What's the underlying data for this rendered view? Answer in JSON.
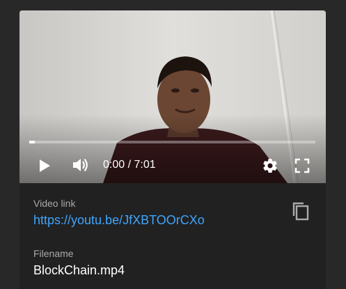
{
  "player": {
    "time_display": "0:00 / 7:01",
    "progress_fraction": 0.02
  },
  "details": {
    "video_link_label": "Video link",
    "video_link_url": "https://youtu.be/JfXBTOOrCXo",
    "filename_label": "Filename",
    "filename_value": "BlockChain.mp4"
  },
  "icons": {
    "play": "play-icon",
    "volume": "volume-icon",
    "settings": "gear-icon",
    "fullscreen": "fullscreen-icon",
    "copy": "copy-icon"
  },
  "colors": {
    "background": "#282828",
    "card": "#212121",
    "link": "#3ea6ff",
    "label": "#aaaaaa"
  }
}
